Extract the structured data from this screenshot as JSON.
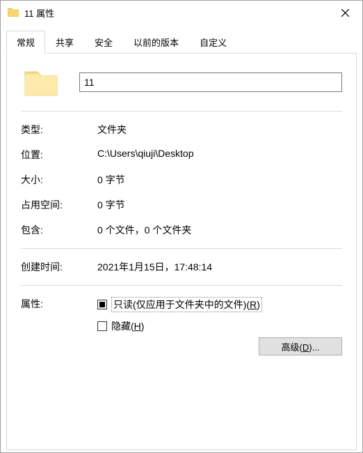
{
  "window": {
    "title": "11 属性"
  },
  "tabs": [
    {
      "label": "常规",
      "active": true
    },
    {
      "label": "共享",
      "active": false
    },
    {
      "label": "安全",
      "active": false
    },
    {
      "label": "以前的版本",
      "active": false
    },
    {
      "label": "自定义",
      "active": false
    }
  ],
  "name": "11",
  "fields": {
    "type_label": "类型:",
    "type_value": "文件夹",
    "location_label": "位置:",
    "location_value": "C:\\Users\\qiuji\\Desktop",
    "size_label": "大小:",
    "size_value": "0 字节",
    "sizeondisk_label": "占用空间:",
    "sizeondisk_value": "0 字节",
    "contains_label": "包含:",
    "contains_value": "0 个文件，0 个文件夹",
    "created_label": "创建时间:",
    "created_value": "2021年1月15日，17:48:14",
    "attributes_label": "属性:"
  },
  "attributes": {
    "readonly_text": "只读(仅应用于文件夹中的文件)(",
    "readonly_key": "R",
    "readonly_suffix": ")",
    "hidden_text": "隐藏(",
    "hidden_key": "H",
    "hidden_suffix": ")",
    "advanced_text": "高级(",
    "advanced_key": "D",
    "advanced_suffix": ")..."
  }
}
